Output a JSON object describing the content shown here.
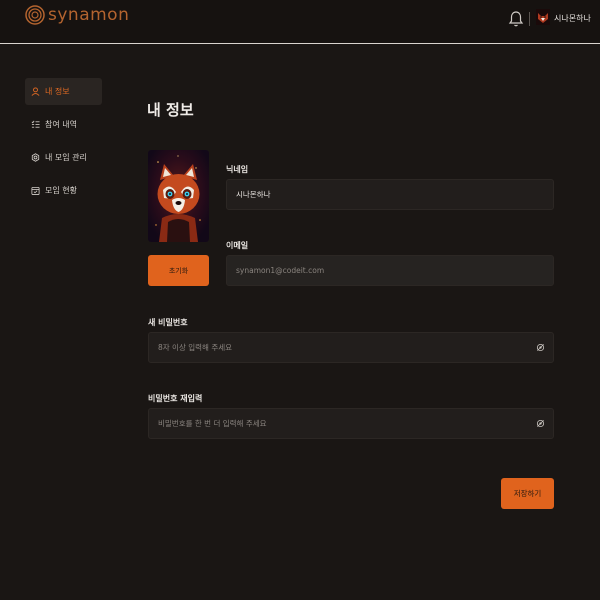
{
  "header": {
    "logo_text": "synamon",
    "username": "시나몬하나"
  },
  "sidebar": {
    "items": [
      {
        "label": "내 정보",
        "icon": "user-icon",
        "active": true
      },
      {
        "label": "참여 내역",
        "icon": "list-icon",
        "active": false
      },
      {
        "label": "내 모임 관리",
        "icon": "settings-icon",
        "active": false
      },
      {
        "label": "모임 현황",
        "icon": "calendar-check-icon",
        "active": false
      }
    ]
  },
  "main": {
    "title": "내 정보",
    "reset_label": "초기화",
    "nickname": {
      "label": "닉네임",
      "value": "시나몬하나"
    },
    "email": {
      "label": "이메일",
      "placeholder": "synamon1@codeit.com"
    },
    "new_password": {
      "label": "새 비밀번호",
      "placeholder": "8자 이상 입력해 주세요"
    },
    "confirm_password": {
      "label": "비밀번호 재입력",
      "placeholder": "비밀번호를 한 번 더 입력해 주세요"
    },
    "save_label": "저장하기"
  },
  "colors": {
    "accent": "#e0631d",
    "background": "#1a1614",
    "field_bg": "#221e1c"
  }
}
